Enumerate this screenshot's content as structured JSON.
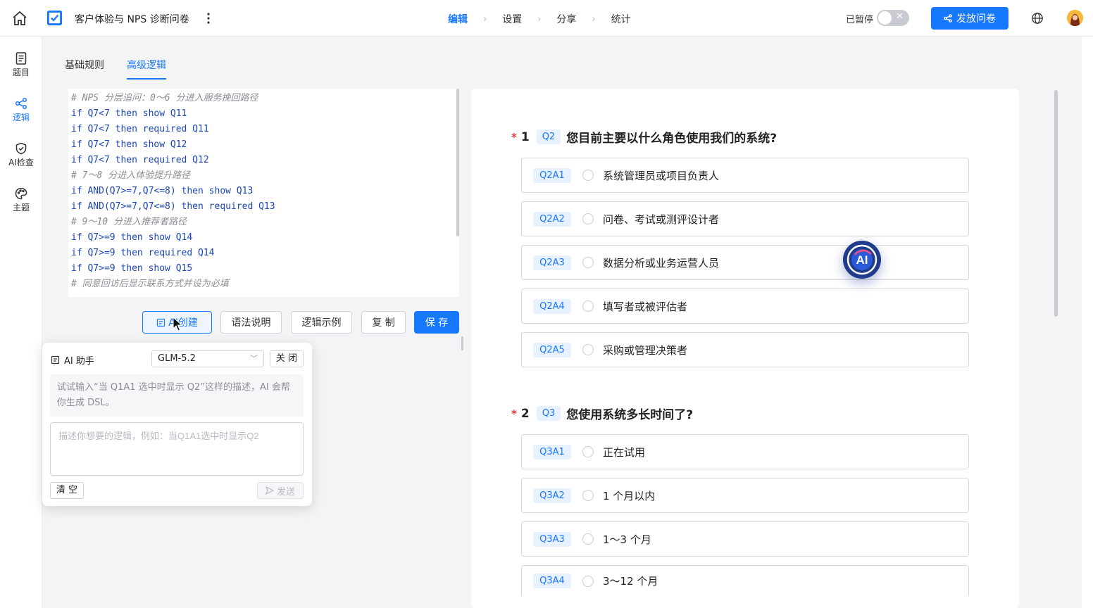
{
  "header": {
    "title": "客户体验与 NPS 诊断问卷",
    "steps": [
      "编辑",
      "设置",
      "分享",
      "统计"
    ],
    "active_step": "编辑",
    "status_label": "已暂停",
    "publish_label": "发放问卷"
  },
  "rail": {
    "items": [
      {
        "label": "题目",
        "icon": "document-icon"
      },
      {
        "label": "逻辑",
        "icon": "share-nodes-icon",
        "active": true
      },
      {
        "label": "AI检查",
        "icon": "shield-check-icon"
      },
      {
        "label": "主题",
        "icon": "palette-icon"
      }
    ]
  },
  "tabs": [
    "基础规则",
    "高级逻辑"
  ],
  "active_tab": "高级逻辑",
  "code": [
    "# NPS 分层追问：0～6 分进入服务挽回路径",
    "if Q7<7 then show Q11",
    "if Q7<7 then required Q11",
    "if Q7<7 then show Q12",
    "if Q7<7 then required Q12",
    "# 7～8 分进入体验提升路径",
    "if AND(Q7>=7,Q7<=8) then show Q13",
    "if AND(Q7>=7,Q7<=8) then required Q13",
    "# 9～10 分进入推荐者路径",
    "if Q7>=9 then show Q14",
    "if Q7>=9 then required Q14",
    "if Q7>=9 then show Q15",
    "# 同意回访后显示联系方式并设为必填"
  ],
  "toolbar": {
    "ai_create": "AI创建",
    "syntax": "语法说明",
    "examples": "逻辑示例",
    "copy": "复 制",
    "save": "保 存"
  },
  "ai_panel": {
    "title": "AI 助手",
    "model": "GLM-5.2",
    "close": "关 闭",
    "hint": "试试输入“当 Q1A1 选中时显示 Q2”这样的描述，AI 会帮你生成 DSL。",
    "placeholder": "描述你想要的逻辑，例如：当Q1A1选中时显示Q2",
    "clear": "清 空",
    "send": "发送"
  },
  "questions": [
    {
      "num": "1",
      "id": "Q2",
      "title": "您目前主要以什么角色使用我们的系统?",
      "options": [
        {
          "id": "Q2A1",
          "text": "系统管理员或项目负责人"
        },
        {
          "id": "Q2A2",
          "text": "问卷、考试或测评设计者"
        },
        {
          "id": "Q2A3",
          "text": "数据分析或业务运营人员"
        },
        {
          "id": "Q2A4",
          "text": "填写者或被评估者"
        },
        {
          "id": "Q2A5",
          "text": "采购或管理决策者"
        }
      ]
    },
    {
      "num": "2",
      "id": "Q3",
      "title": "您使用系统多长时间了?",
      "options": [
        {
          "id": "Q3A1",
          "text": "正在试用"
        },
        {
          "id": "Q3A2",
          "text": "1 个月以内"
        },
        {
          "id": "Q3A3",
          "text": "1～3 个月"
        },
        {
          "id": "Q3A4",
          "text": "3～12 个月"
        }
      ]
    }
  ],
  "ai_float_label": "AI",
  "colors": {
    "accent": "#1677ff",
    "required": "#e63b3b"
  }
}
